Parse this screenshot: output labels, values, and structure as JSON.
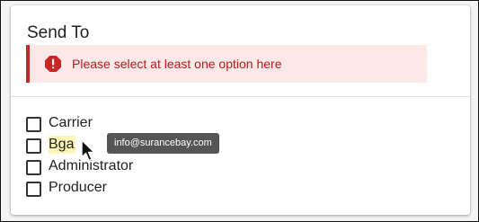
{
  "card": {
    "title": "Send To"
  },
  "alert": {
    "icon": "error-octagon-icon",
    "message": "Please select at least one option here",
    "color": "#c62828",
    "background": "#fde8e8"
  },
  "options": [
    {
      "label": "Carrier",
      "checked": false
    },
    {
      "label": "Bga",
      "checked": false,
      "highlighted": true
    },
    {
      "label": "Administrator",
      "checked": false
    },
    {
      "label": "Producer",
      "checked": false
    }
  ],
  "tooltip": {
    "text": "info@surancebay.com"
  },
  "cursor": {
    "icon": "mouse-pointer-icon"
  }
}
